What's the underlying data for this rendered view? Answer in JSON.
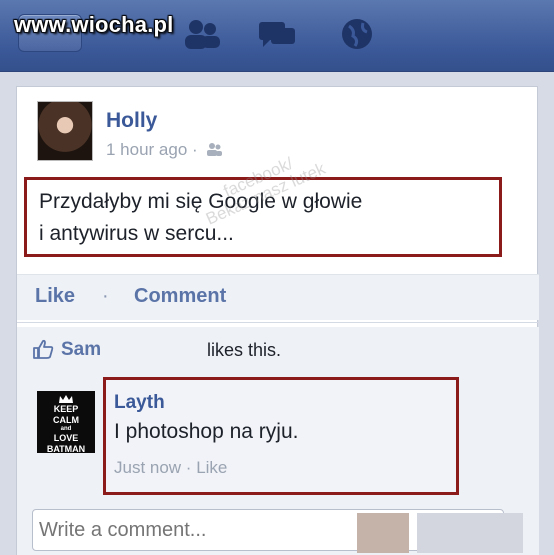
{
  "watermark": "www.wiocha.pl",
  "nav": {
    "icons": [
      "back-icon",
      "friends-icon",
      "messages-icon",
      "notifications-globe-icon"
    ]
  },
  "post": {
    "author": "Holly",
    "time": "1 hour ago ·",
    "audience_icon": "friends-audience-icon",
    "text_line1": "Przydałyby mi się Google w głowie",
    "text_line2": "i antywirus w sercu...",
    "overlay_watermark_1": "facebook/",
    "overlay_watermark_2": "Bekaz nasz lutek"
  },
  "actions": {
    "like_label": "Like",
    "separator": "·",
    "comment_label": "Comment"
  },
  "likes": {
    "name": "Sam",
    "text": "likes this."
  },
  "comment": {
    "avatar_lines": [
      "KEEP",
      "CALM",
      "and",
      "LOVE",
      "BATMAN"
    ],
    "author": "Layth",
    "text": "I photoshop na ryju.",
    "meta": "Just now · Like"
  },
  "composer": {
    "placeholder": "Write a comment..."
  },
  "colors": {
    "header_blue": "#3b5898",
    "link_blue": "#3b5998",
    "highlight_border": "#8b1a1a"
  }
}
